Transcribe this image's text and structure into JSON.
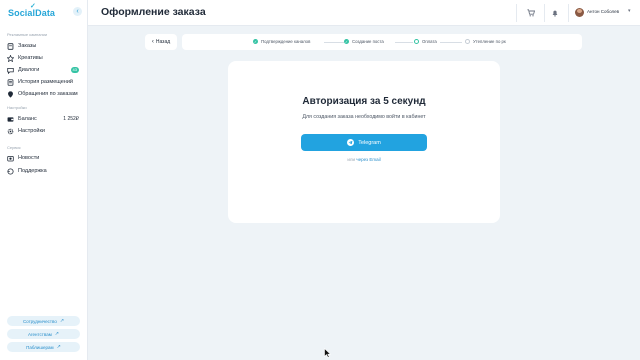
{
  "sidebar": {
    "logo": "SocialData",
    "collapse_icon": "‹",
    "sections": {
      "ads": "Рекламные кампании",
      "settings": "Настройки",
      "service": "Сервис"
    },
    "items": [
      {
        "label": "Заказы",
        "icon": "cart-icon"
      },
      {
        "label": "Креативы",
        "icon": "star-icon"
      },
      {
        "label": "Диалоги",
        "icon": "chat-icon",
        "badge": "43"
      },
      {
        "label": "История размещений",
        "icon": "history-icon"
      },
      {
        "label": "Обращения по заказам",
        "icon": "support-icon"
      }
    ],
    "settings_items": [
      {
        "label": "Баланс",
        "icon": "wallet-icon",
        "value": "1 252₽"
      },
      {
        "label": "Настройки",
        "icon": "gear-icon"
      }
    ],
    "service_items": [
      {
        "label": "Новости",
        "icon": "news-icon"
      },
      {
        "label": "Поддержка",
        "icon": "help-icon"
      }
    ],
    "bottom_buttons": [
      "Сотрудничество",
      "Агентствам",
      "Паблишерам"
    ],
    "bottom_arrow": "↗"
  },
  "header": {
    "title": "Оформление заказа",
    "user_name": "Антон Соболев",
    "user_chevron": "▾"
  },
  "steps": {
    "back_label": "Назад",
    "back_chevron": "‹",
    "check": "✓",
    "items": [
      {
        "label": "Подтверждение каналов",
        "state": "done"
      },
      {
        "label": "Создание поста",
        "state": "done"
      },
      {
        "label": "Оплата",
        "state": "current"
      },
      {
        "label": "Утепление по рк",
        "state": "todo"
      }
    ]
  },
  "auth": {
    "title": "Авторизация за 5 секунд",
    "subtitle": "Для создания заказа необходимо войти в кабинет",
    "telegram_label": "Telegram",
    "or_prefix": "или",
    "email_link": "через Email"
  },
  "colors": {
    "accent": "#22a3e0",
    "success": "#34c3a4",
    "background": "#eef3f7"
  }
}
